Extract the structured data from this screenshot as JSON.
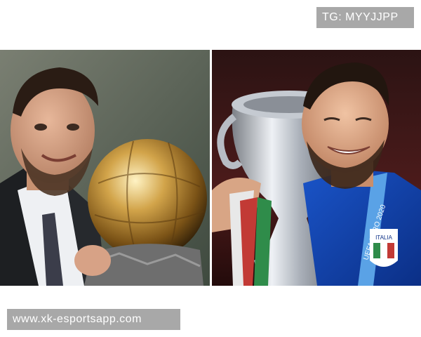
{
  "watermark_top": "TG: MYYJJPP",
  "watermark_bottom": "www.xk-esportsapp.com",
  "images": {
    "left": {
      "subject": "man in dark suit smiling holding a golden ball trophy"
    },
    "right": {
      "subject": "man in blue football jersey kissing a silver cup trophy"
    }
  },
  "jersey_text": "UEFA EURO 2020",
  "crest_text": "ITALIA"
}
